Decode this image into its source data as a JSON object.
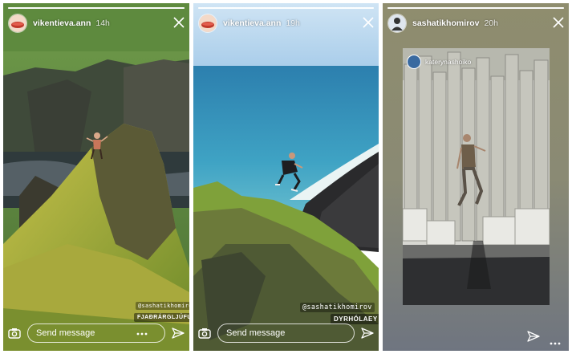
{
  "stories": [
    {
      "username": "vikentieva.ann",
      "time": "14h",
      "message_placeholder": "Send message",
      "mention": "@sashatikhomirov",
      "location": "FJAÐRÁRGLJÚFUR"
    },
    {
      "username": "vikentieva.ann",
      "time": "19h",
      "message_placeholder": "Send message",
      "mention": "@sashatikhomirov",
      "location": "DYRHÓLAEY"
    },
    {
      "username": "sashatikhomirov",
      "time": "20h",
      "repost_username": "katerynashoiko"
    }
  ],
  "icons": {
    "close": "close-icon",
    "camera": "camera-icon",
    "send": "send-icon",
    "more": "more-dots-icon"
  }
}
